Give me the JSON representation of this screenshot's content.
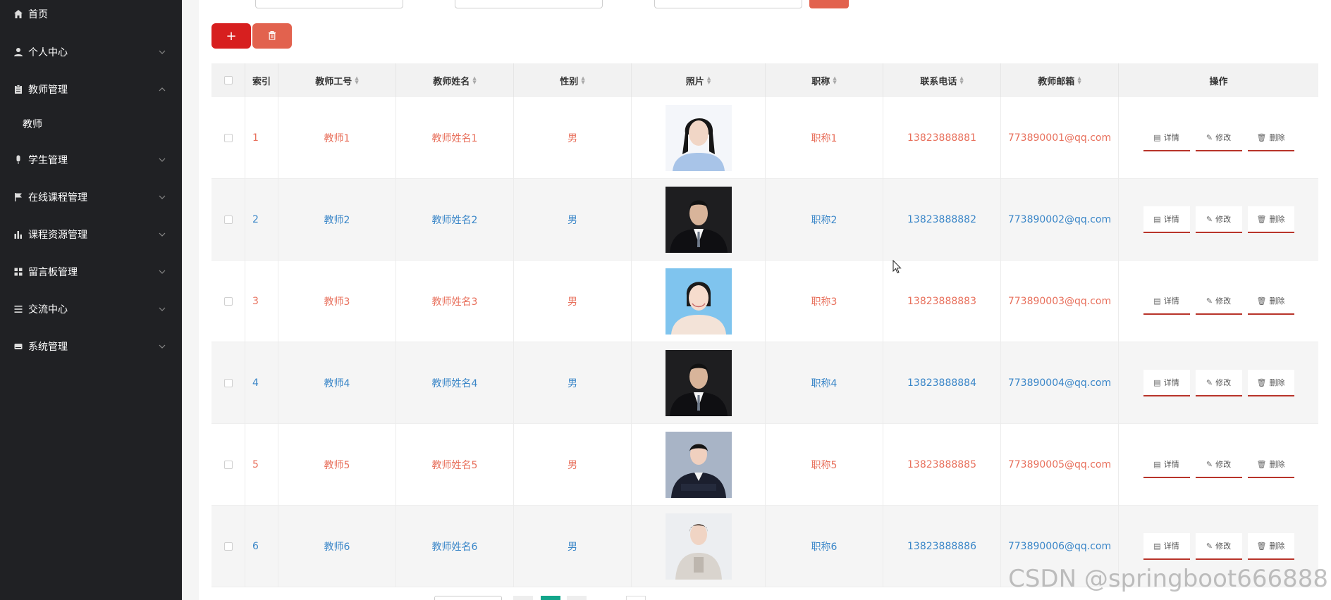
{
  "sidebar": {
    "items": [
      {
        "label": "首页",
        "icon": "home-icon",
        "top": 0
      },
      {
        "label": "个人中心",
        "icon": "user-icon"
      },
      {
        "label": "教师管理",
        "icon": "clipboard-icon"
      },
      {
        "label": "教师",
        "sub": true
      },
      {
        "label": "学生管理",
        "icon": "mic-icon"
      },
      {
        "label": "在线课程管理",
        "icon": "flag-icon"
      },
      {
        "label": "课程资源管理",
        "icon": "bar-chart-icon"
      },
      {
        "label": "留言板管理",
        "icon": "grid-icon"
      },
      {
        "label": "交流中心",
        "icon": "list-icon"
      },
      {
        "label": "系统管理",
        "icon": "drive-icon"
      }
    ]
  },
  "toolbar": {
    "add_label": "+",
    "delete_icon": "trash-icon"
  },
  "table": {
    "headers": {
      "index": "索引",
      "teacher_no": "教师工号",
      "teacher_name": "教师姓名",
      "gender": "性别",
      "photo": "照片",
      "title": "职称",
      "phone": "联系电话",
      "email": "教师邮箱",
      "ops": "操作"
    },
    "op_labels": {
      "detail": "详情",
      "edit": "修改",
      "delete": "删除"
    },
    "rows": [
      {
        "index": "1",
        "teacher_no": "教师1",
        "teacher_name": "教师姓名1",
        "gender": "男",
        "title": "职称1",
        "phone": "13823888881",
        "email": "773890001@qq.com"
      },
      {
        "index": "2",
        "teacher_no": "教师2",
        "teacher_name": "教师姓名2",
        "gender": "男",
        "title": "职称2",
        "phone": "13823888882",
        "email": "773890002@qq.com"
      },
      {
        "index": "3",
        "teacher_no": "教师3",
        "teacher_name": "教师姓名3",
        "gender": "男",
        "title": "职称3",
        "phone": "13823888883",
        "email": "773890003@qq.com"
      },
      {
        "index": "4",
        "teacher_no": "教师4",
        "teacher_name": "教师姓名4",
        "gender": "男",
        "title": "职称4",
        "phone": "13823888884",
        "email": "773890004@qq.com"
      },
      {
        "index": "5",
        "teacher_no": "教师5",
        "teacher_name": "教师姓名5",
        "gender": "男",
        "title": "职称5",
        "phone": "13823888885",
        "email": "773890005@qq.com"
      },
      {
        "index": "6",
        "teacher_no": "教师6",
        "teacher_name": "教师姓名6",
        "gender": "男",
        "title": "职称6",
        "phone": "13823888886",
        "email": "773890006@qq.com"
      }
    ]
  },
  "watermark": "CSDN @springboot666888",
  "colors": {
    "sidebar_bg": "#202124",
    "accent_red": "#d71f1f",
    "accent_orange": "#e2624e",
    "text_red": "#e8705c",
    "text_blue": "#3a86c8",
    "pager_active": "#12a58a"
  }
}
